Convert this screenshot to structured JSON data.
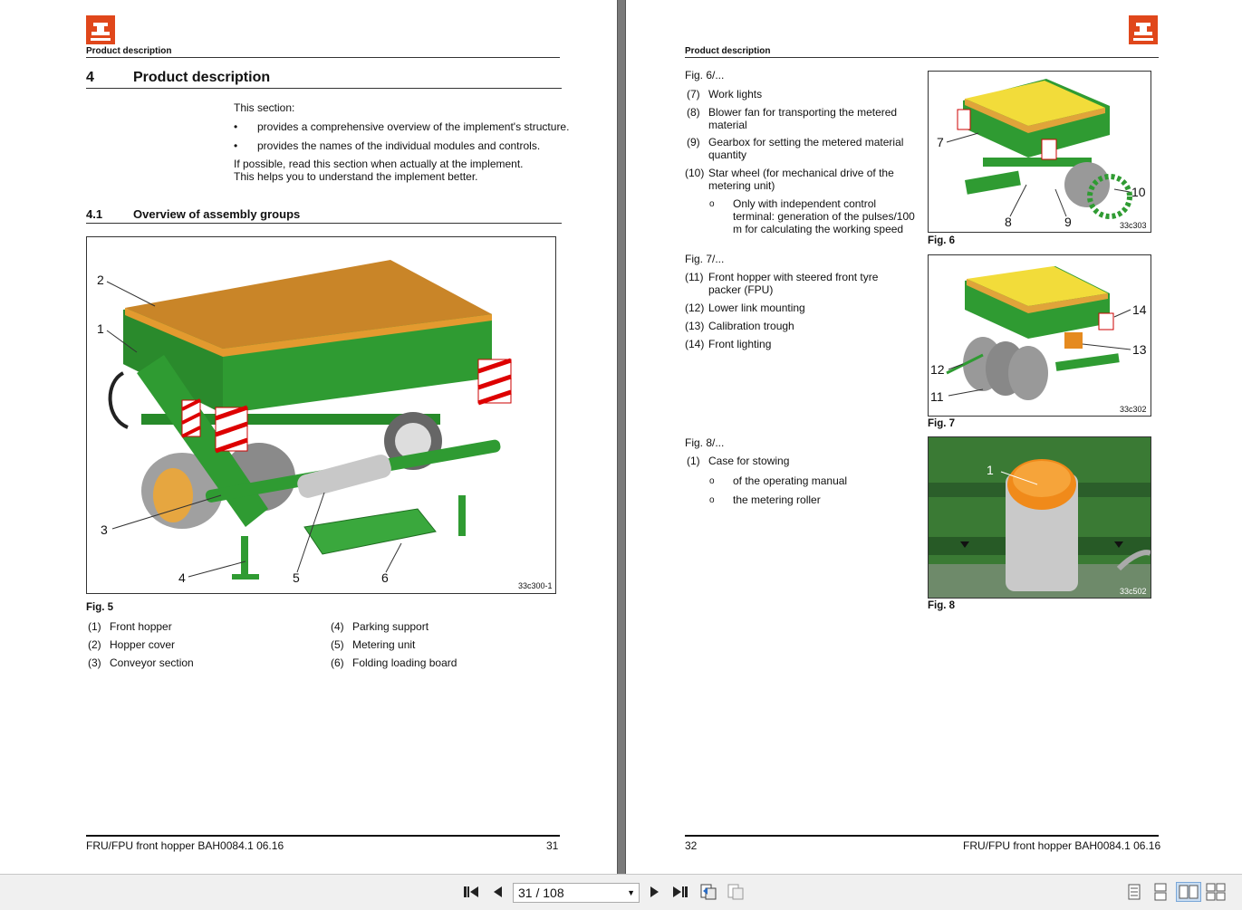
{
  "left_page": {
    "running_header": "Product description",
    "heading_num": "4",
    "heading_title": "Product description",
    "intro": "This section:",
    "bullets": [
      "provides a comprehensive overview of the implement's structure.",
      "provides the names of the individual modules and controls."
    ],
    "intro_note": "If possible, read this section when actually at the implement. This helps you to understand the implement better.",
    "subheading_num": "4.1",
    "subheading_title": "Overview of assembly groups",
    "figure_code": "33c300-1",
    "figure_caption": "Fig. 5",
    "callouts": [
      "2",
      "1",
      "3",
      "4",
      "5",
      "6"
    ],
    "legend_left": [
      {
        "num": "(1)",
        "text": "Front hopper"
      },
      {
        "num": "(2)",
        "text": "Hopper cover"
      },
      {
        "num": "(3)",
        "text": "Conveyor section"
      }
    ],
    "legend_right": [
      {
        "num": "(4)",
        "text": "Parking support"
      },
      {
        "num": "(5)",
        "text": "Metering unit"
      },
      {
        "num": "(6)",
        "text": "Folding loading board"
      }
    ],
    "footer_title": "FRU/FPU front hopper  BAH0084.1  06.16",
    "page_number": "31"
  },
  "right_page": {
    "running_header": "Product description",
    "fig6_ref": "Fig. 6/...",
    "fig6_items": [
      {
        "num": "(7)",
        "text": "Work lights"
      },
      {
        "num": "(8)",
        "text": "Blower fan for transporting the metered material"
      },
      {
        "num": "(9)",
        "text": "Gearbox for setting the metered material quantity"
      },
      {
        "num": "(10)",
        "text": "Star wheel (for mechanical drive of the metering unit)"
      }
    ],
    "fig6_sub": {
      "marker": "o",
      "text": "Only with independent control terminal: generation of the pulses/100 m for calculating the working speed"
    },
    "fig7_ref": "Fig. 7/...",
    "fig7_items": [
      {
        "num": "(11)",
        "text": "Front hopper with steered front tyre packer (FPU)"
      },
      {
        "num": "(12)",
        "text": "Lower link mounting"
      },
      {
        "num": "(13)",
        "text": "Calibration trough"
      },
      {
        "num": "(14)",
        "text": "Front lighting"
      }
    ],
    "fig8_ref": "Fig. 8/...",
    "fig8_items": [
      {
        "num": "(1)",
        "text": "Case for stowing"
      }
    ],
    "fig8_subs": [
      {
        "marker": "o",
        "text": "of the operating manual"
      },
      {
        "marker": "o",
        "text": "the metering roller"
      }
    ],
    "fig6": {
      "code": "33c303",
      "caption": "Fig. 6",
      "callouts": [
        "7",
        "8",
        "9",
        "10"
      ]
    },
    "fig7": {
      "code": "33c302",
      "caption": "Fig. 7",
      "callouts": [
        "14",
        "13",
        "12",
        "11"
      ]
    },
    "fig8": {
      "code": "33c502",
      "caption": "Fig. 8",
      "callouts": [
        "1"
      ]
    },
    "footer_title": "FRU/FPU front hopper  BAH0084.1  06.16",
    "page_number": "32"
  },
  "toolbar": {
    "page_indicator": "31 / 108",
    "icons": [
      "first-page-icon",
      "previous-page-icon",
      "next-page-icon",
      "last-page-icon",
      "back-view-icon",
      "forward-view-icon",
      "single-page-icon",
      "continuous-icon",
      "facing-icon",
      "continuous-facing-icon"
    ]
  },
  "colors": {
    "green": "#2e9e2e",
    "orange_cover": "#d98c2a",
    "yellow_cover": "#f0d830",
    "logo": "#e0471b"
  }
}
